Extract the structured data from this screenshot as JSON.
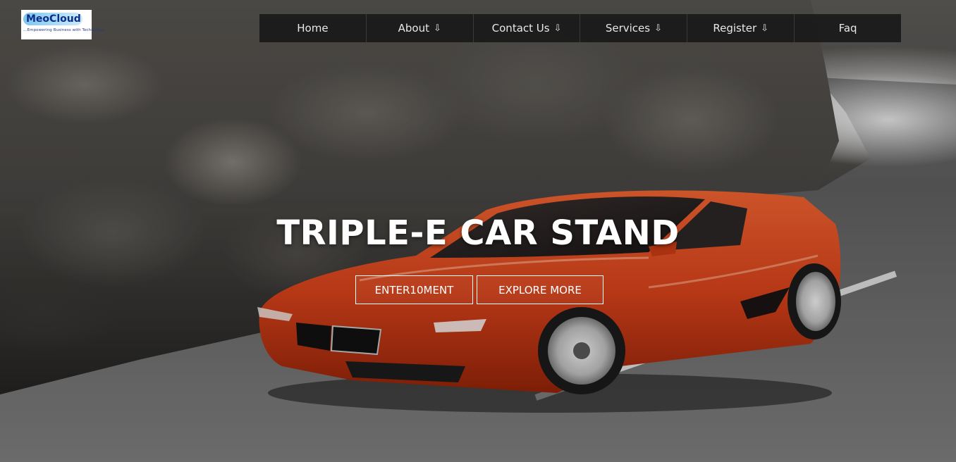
{
  "logo": {
    "brand": "MeoCloud",
    "tagline": "...Empowering Business with Technology"
  },
  "nav": {
    "items": [
      {
        "label": "Home",
        "arrow": ""
      },
      {
        "label": "About",
        "arrow": "⇩"
      },
      {
        "label": "Contact Us",
        "arrow": "⇩"
      },
      {
        "label": "Services",
        "arrow": "⇩"
      },
      {
        "label": "Register",
        "arrow": "⇩"
      },
      {
        "label": "Faq",
        "arrow": ""
      }
    ]
  },
  "hero": {
    "title": "TRIPLE-E CAR STAND",
    "buttons": {
      "entertainment": "ENTER10MENT",
      "explore": "EXPLORE MORE"
    }
  },
  "colors": {
    "car_body": "#d4441c",
    "nav_bg": "#141414",
    "text": "#ffffff"
  }
}
